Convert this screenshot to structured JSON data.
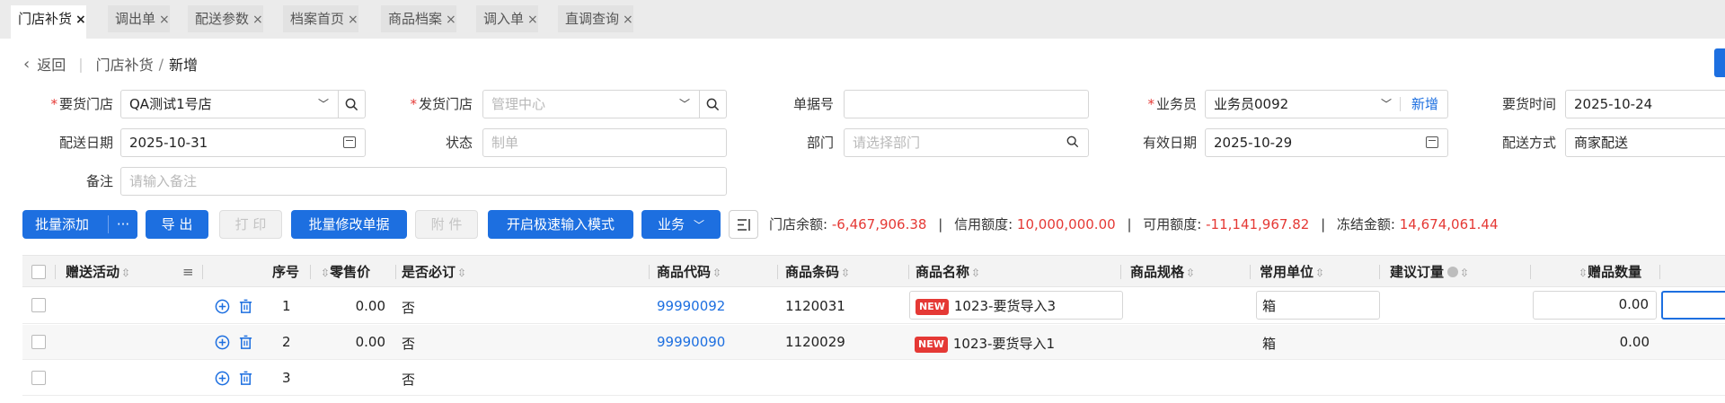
{
  "tabs": [
    {
      "label": "门店补货",
      "active": true
    },
    {
      "label": "调出单",
      "active": false
    },
    {
      "label": "配送参数",
      "active": false
    },
    {
      "label": "档案首页",
      "active": false
    },
    {
      "label": "商品档案",
      "active": false
    },
    {
      "label": "调入单",
      "active": false
    },
    {
      "label": "直调查询",
      "active": false
    }
  ],
  "tab_close": "×",
  "breadcrumb": {
    "back": "返回",
    "parent": "门店补货",
    "current": "新增",
    "slash": "/"
  },
  "form": {
    "request_store": {
      "label": "要货门店",
      "value": "QA测试1号店"
    },
    "ship_store": {
      "label": "发货门店",
      "placeholder": "管理中心"
    },
    "doc_no": {
      "label": "单据号",
      "value": ""
    },
    "salesman": {
      "label": "业务员",
      "value": "业务员0092",
      "add": "新增"
    },
    "request_time": {
      "label": "要货时间",
      "value": "2025-10-24"
    },
    "delivery_date": {
      "label": "配送日期",
      "value": "2025-10-31"
    },
    "status": {
      "label": "状态",
      "placeholder": "制单"
    },
    "dept": {
      "label": "部门",
      "placeholder": "请选择部门"
    },
    "valid_date": {
      "label": "有效日期",
      "value": "2025-10-29"
    },
    "delivery_method": {
      "label": "配送方式",
      "value": "商家配送"
    },
    "remark": {
      "label": "备注",
      "placeholder": "请输入备注"
    },
    "required_mark": "*"
  },
  "toolbar": {
    "batch_add": "批量添加",
    "more": "···",
    "export": "导 出",
    "print": "打 印",
    "batch_edit": "批量修改单据",
    "attach": "附 件",
    "fast_input": "开启极速输入模式",
    "business": "业务"
  },
  "summary": {
    "balance_label": "门店余额:",
    "balance": "-6,467,906.38",
    "credit_label": "信用额度:",
    "credit": "10,000,000.00",
    "available_label": "可用额度:",
    "available": "-11,141,967.82",
    "frozen_label": "冻结金额:",
    "frozen": "14,674,061.44",
    "sep": "|"
  },
  "table": {
    "headers": {
      "gift_activity": "赠送活动",
      "seq": "序号",
      "retail_price": "零售价",
      "required": "是否必订",
      "item_code": "商品代码",
      "barcode": "商品条码",
      "item_name": "商品名称",
      "spec": "商品规格",
      "unit": "常用单位",
      "suggest_qty": "建议订量",
      "gift_qty": "赠品数量"
    },
    "new_tag": "NEW",
    "rows": [
      {
        "seq": "1",
        "retail_price": "0.00",
        "required": "否",
        "item_code": "99990092",
        "barcode": "1120031",
        "item_name": "1023-要货导入3",
        "unit": "箱",
        "gift_qty": "0.00"
      },
      {
        "seq": "2",
        "retail_price": "0.00",
        "required": "否",
        "item_code": "99990090",
        "barcode": "1120029",
        "item_name": "1023-要货导入1",
        "unit": "箱",
        "gift_qty": "0.00"
      },
      {
        "seq": "3",
        "retail_price": "",
        "required": "否",
        "item_code": "",
        "barcode": "",
        "item_name": "",
        "unit": "",
        "gift_qty": ""
      }
    ]
  }
}
